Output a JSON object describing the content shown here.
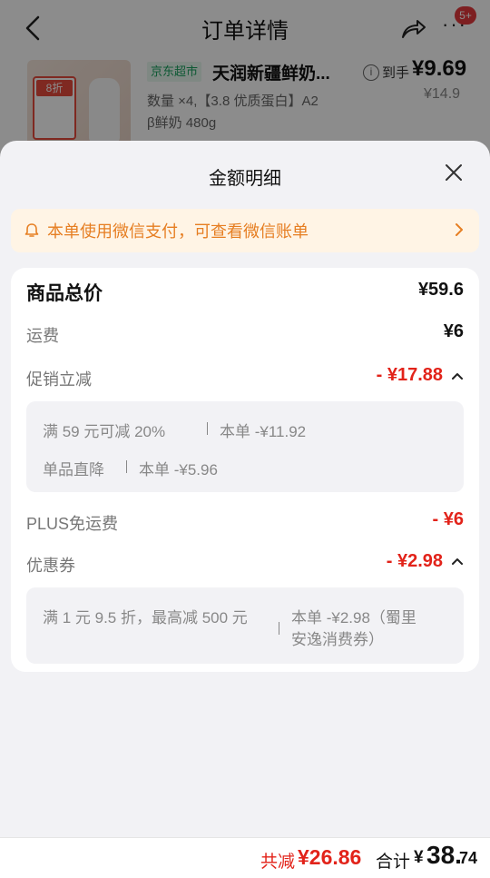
{
  "nav": {
    "title": "订单详情",
    "badge": "5+"
  },
  "product": {
    "store_tag": "京东超市",
    "name": "天润新疆鲜奶...",
    "desc_line1": "数量 ×4,【3.8 优质蛋白】A2",
    "desc_line2": "β鲜奶 480g",
    "thumb_tag": "8折",
    "to_hand_label": "到手",
    "to_hand_price": "¥9.69",
    "original_price": "¥14.9"
  },
  "sheet": {
    "title": "金额明细",
    "notice": "本单使用微信支付，可查看微信账单",
    "rows": {
      "subtotal_label": "商品总价",
      "subtotal_value": "¥59.6",
      "shipping_label": "运费",
      "shipping_value": "¥6",
      "promo_label": "促销立减",
      "promo_value": "- ¥17.88",
      "plus_label": "PLUS免运费",
      "plus_value": "- ¥6",
      "coupon_label": "优惠券",
      "coupon_value": "- ¥2.98"
    },
    "promo_details": [
      {
        "name": "满 59 元可减 20%",
        "amount": "本单 -¥11.92"
      },
      {
        "name": "单品直降",
        "amount": "本单 -¥5.96"
      }
    ],
    "coupon_details": {
      "name": "满 1 元 9.5 折，最高减 500 元",
      "amount_line1": "本单 -¥2.98（蜀里",
      "amount_line2": "安逸消费券）"
    }
  },
  "bottom": {
    "saved_label": "共减",
    "saved_amount": "¥26.86",
    "total_label": "合计",
    "total_currency": "¥",
    "total_int": "38.",
    "total_dec": "74"
  },
  "colors": {
    "accent_red": "#e2231a",
    "notice_orange": "#e67e22",
    "notice_bg": "#fff4e5",
    "store_green": "#1aa260"
  }
}
